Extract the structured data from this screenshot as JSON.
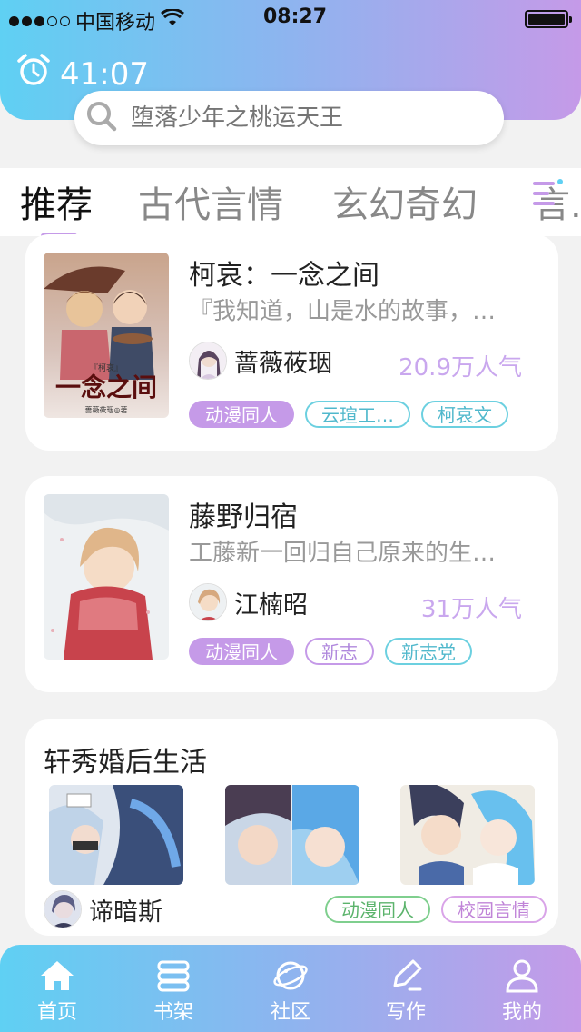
{
  "status": {
    "carrier": "中国移动",
    "time": "08:27"
  },
  "timer": {
    "value": "41:07"
  },
  "search": {
    "placeholder": "堕落少年之桃运天王"
  },
  "tabs": [
    {
      "label": "推荐"
    },
    {
      "label": "古代言情"
    },
    {
      "label": "玄幻奇幻"
    },
    {
      "label": "言..."
    }
  ],
  "books": [
    {
      "title": "柯哀：一念之间",
      "desc": "『我知道，山是水的故事，…",
      "author": "蔷薇莜珚",
      "popularity": "20.9万人气",
      "tags": [
        "动漫同人",
        "云瑄工…",
        "柯哀文"
      ]
    },
    {
      "title": "藤野归宿",
      "desc": "工藤新一回归自己原来的生…",
      "author": "江楠昭",
      "popularity": "31万人气",
      "tags": [
        "动漫同人",
        "新志",
        "新志党"
      ]
    }
  ],
  "featured": {
    "title": "轩秀婚后生活",
    "author": "谛暗斯",
    "tags": [
      "动漫同人",
      "校园言情"
    ]
  },
  "cover_text": {
    "small": "『柯哀』",
    "big": "一念之间",
    "credit": "蔷薇莜珚◎著"
  },
  "nav": [
    {
      "label": "首页",
      "icon": "home-icon"
    },
    {
      "label": "书架",
      "icon": "bookshelf-icon"
    },
    {
      "label": "社区",
      "icon": "planet-icon"
    },
    {
      "label": "写作",
      "icon": "pen-icon"
    },
    {
      "label": "我的",
      "icon": "person-icon"
    }
  ],
  "colors": {
    "accent": "#c59ae8",
    "gradient_start": "#5fd0f3",
    "gradient_end": "#c59ae8",
    "popularity": "#c9a7ee"
  }
}
